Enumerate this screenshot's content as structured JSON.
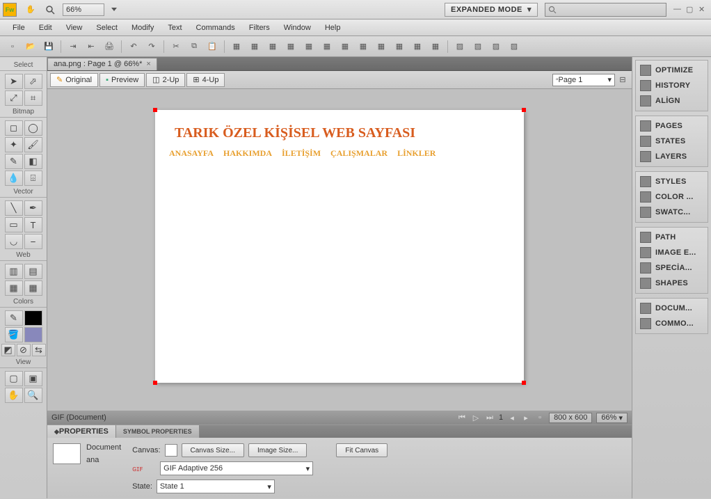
{
  "topbar": {
    "zoom": "66%",
    "mode_label": "EXPANDED MODE"
  },
  "menu": [
    "File",
    "Edit",
    "View",
    "Select",
    "Modify",
    "Text",
    "Commands",
    "Filters",
    "Window",
    "Help"
  ],
  "doc_tab": {
    "label": "ana.png : Page 1 @ 66%*"
  },
  "view_tabs": {
    "original": "Original",
    "preview": "Preview",
    "up2": "2-Up",
    "up4": "4-Up"
  },
  "page_selector": "Page 1",
  "status": {
    "doc_type": "GIF (Document)",
    "page_num": "1",
    "dims": "800 x 600",
    "zoom": "66%"
  },
  "canvas": {
    "title": "TARIK ÖZEL KİŞİSEL WEB SAYFASI",
    "nav": [
      "ANASAYFA",
      "HAKKIMDA",
      "İLETİŞİM",
      "ÇALIŞMALAR",
      "LİNKLER"
    ]
  },
  "tool_panel": {
    "t_select": "Select",
    "t_bitmap": "Bitmap",
    "t_vector": "Vector",
    "t_web": "Web",
    "t_colors": "Colors",
    "t_view": "View"
  },
  "properties": {
    "tab1": "PROPERTIES",
    "tab2": "SYMBOL PROPERTIES",
    "doc_label": "Document",
    "doc_name": "ana",
    "canvas_label": "Canvas:",
    "canvas_size": "Canvas Size...",
    "image_size": "Image Size...",
    "fit_canvas": "Fit Canvas",
    "gif_label": "GIF Adaptive 256",
    "state_label": "State:",
    "state_val": "State 1"
  },
  "panels": {
    "g1": [
      "OPTIMIZE",
      "HISTORY",
      "ALİGN"
    ],
    "g2": [
      "PAGES",
      "STATES",
      "LAYERS"
    ],
    "g3": [
      "STYLES",
      "COLOR ...",
      "SWATC..."
    ],
    "g4": [
      "PATH",
      "IMAGE E...",
      "SPECİA...",
      "SHAPES"
    ],
    "g5": [
      "DOCUM...",
      "COMMO..."
    ]
  }
}
